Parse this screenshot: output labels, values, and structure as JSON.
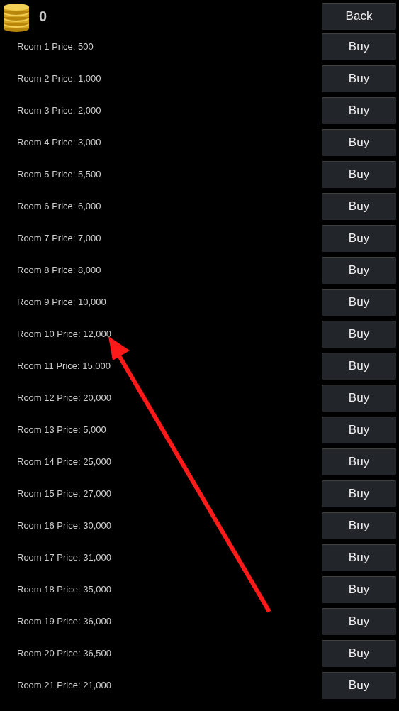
{
  "coins": "0",
  "back_button": "Back",
  "rooms": [
    {
      "label": "Room 1 Price: 500",
      "button": "Buy"
    },
    {
      "label": "Room 2 Price: 1,000",
      "button": "Buy"
    },
    {
      "label": "Room 3 Price: 2,000",
      "button": "Buy"
    },
    {
      "label": "Room 4 Price: 3,000",
      "button": "Buy"
    },
    {
      "label": "Room 5 Price: 5,500",
      "button": "Buy"
    },
    {
      "label": "Room 6 Price: 6,000",
      "button": "Buy"
    },
    {
      "label": "Room 7 Price: 7,000",
      "button": "Buy"
    },
    {
      "label": "Room 8 Price: 8,000",
      "button": "Buy"
    },
    {
      "label": "Room 9 Price: 10,000",
      "button": "Buy"
    },
    {
      "label": "Room 10 Price: 12,000",
      "button": "Buy"
    },
    {
      "label": "Room 11 Price: 15,000",
      "button": "Buy"
    },
    {
      "label": "Room 12 Price: 20,000",
      "button": "Buy"
    },
    {
      "label": "Room 13 Price: 5,000",
      "button": "Buy"
    },
    {
      "label": "Room 14 Price: 25,000",
      "button": "Buy"
    },
    {
      "label": "Room 15 Price: 27,000",
      "button": "Buy"
    },
    {
      "label": "Room 16 Price: 30,000",
      "button": "Buy"
    },
    {
      "label": "Room 17 Price: 31,000",
      "button": "Buy"
    },
    {
      "label": "Room 18 Price: 35,000",
      "button": "Buy"
    },
    {
      "label": "Room 19 Price: 36,000",
      "button": "Buy"
    },
    {
      "label": "Room 20 Price: 36,500",
      "button": "Buy"
    },
    {
      "label": "Room 21 Price: 21,000",
      "button": "Buy"
    }
  ]
}
